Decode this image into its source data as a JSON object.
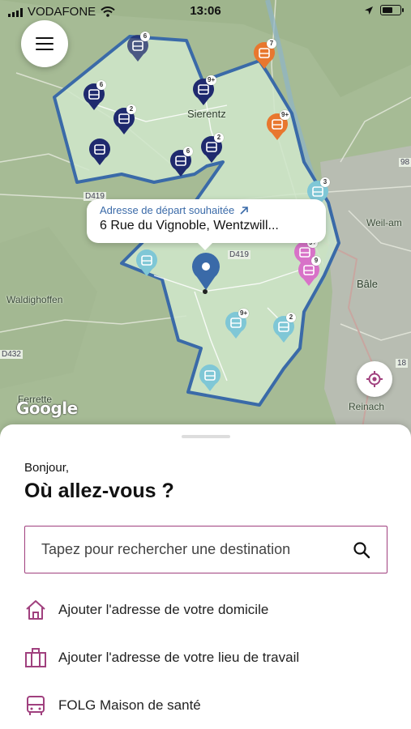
{
  "status_bar": {
    "carrier": "VODAFONE",
    "time": "13:06",
    "battery_level": 0.6
  },
  "map": {
    "callout": {
      "title": "Adresse de départ souhaitée",
      "address": "6 Rue du Vignoble, Wentzwill..."
    },
    "labels": {
      "sierentz": "Sierentz",
      "waldighoffen": "Waldighoffen",
      "bale": "Bâle",
      "weil": "Weil-am",
      "reinach": "Reinach",
      "ferrette": "Ferrette",
      "d419_a": "D419",
      "d419_b": "D419",
      "d432": "D432",
      "r98": "98",
      "r18": "18"
    },
    "stops": {
      "s1": "6",
      "s2": "6",
      "s3": "2",
      "s4": "9+",
      "s5": "7",
      "s6": "9+",
      "s7": "6",
      "s8": "2",
      "s9": "3",
      "s10": "9+",
      "s11": "9",
      "s12": "9+",
      "s13": "2"
    },
    "attribution": "Google",
    "colors": {
      "zone_fill": "#cfe6c9",
      "zone_border": "#3a6aa8",
      "stop_dark": "#1f2a6e",
      "stop_orange": "#e8772e",
      "stop_teal": "#7fc7d6",
      "stop_pink": "#d872c8"
    }
  },
  "sheet": {
    "greeting": "Bonjour,",
    "question": "Où allez-vous ?",
    "search_placeholder": "Tapez pour rechercher une destination",
    "items": [
      {
        "label": "Ajouter l'adresse de votre domicile",
        "icon": "home-icon"
      },
      {
        "label": "Ajouter l'adresse de votre lieu de travail",
        "icon": "briefcase-icon"
      },
      {
        "label": "FOLG Maison de santé",
        "icon": "bus-icon"
      }
    ],
    "accent": "#a0407e"
  }
}
